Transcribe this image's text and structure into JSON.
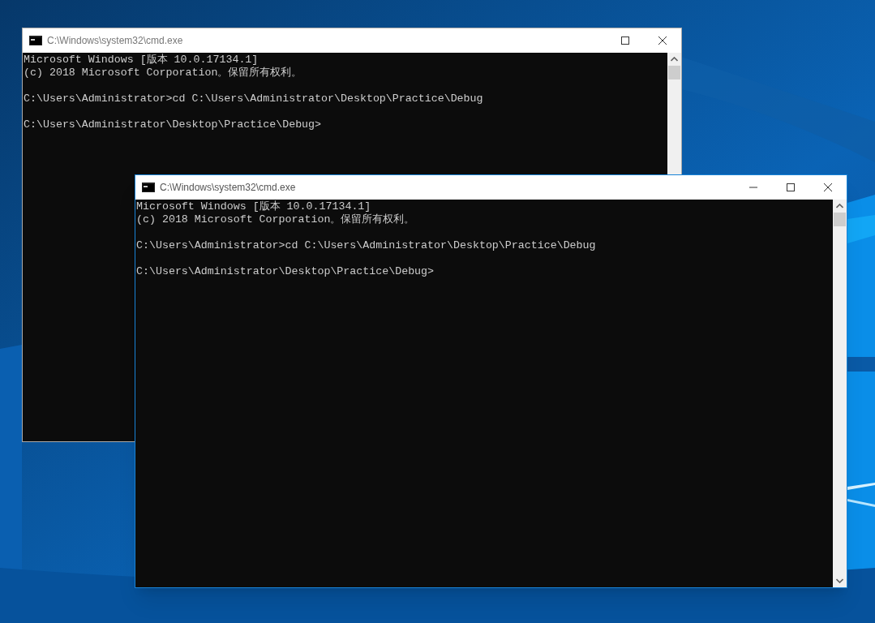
{
  "windows": [
    {
      "title": "C:\\Windows\\system32\\cmd.exe",
      "active": false,
      "title_buttons": [
        {
          "kind": "maximize"
        },
        {
          "kind": "close"
        }
      ],
      "blocks": [
        [
          "Microsoft Windows [版本 10.0.17134.1]",
          "(c) 2018 Microsoft Corporation。保留所有权利。"
        ],
        [
          "C:\\Users\\Administrator>cd C:\\Users\\Administrator\\Desktop\\Practice\\Debug"
        ],
        [
          "C:\\Users\\Administrator\\Desktop\\Practice\\Debug>"
        ]
      ]
    },
    {
      "title": "C:\\Windows\\system32\\cmd.exe",
      "active": true,
      "title_buttons": [
        {
          "kind": "minimize"
        },
        {
          "kind": "maximize"
        },
        {
          "kind": "close"
        }
      ],
      "blocks": [
        [
          "Microsoft Windows [版本 10.0.17134.1]",
          "(c) 2018 Microsoft Corporation。保留所有权利。"
        ],
        [
          "C:\\Users\\Administrator>cd C:\\Users\\Administrator\\Desktop\\Practice\\Debug"
        ],
        [
          "C:\\Users\\Administrator\\Desktop\\Practice\\Debug>"
        ]
      ]
    }
  ]
}
